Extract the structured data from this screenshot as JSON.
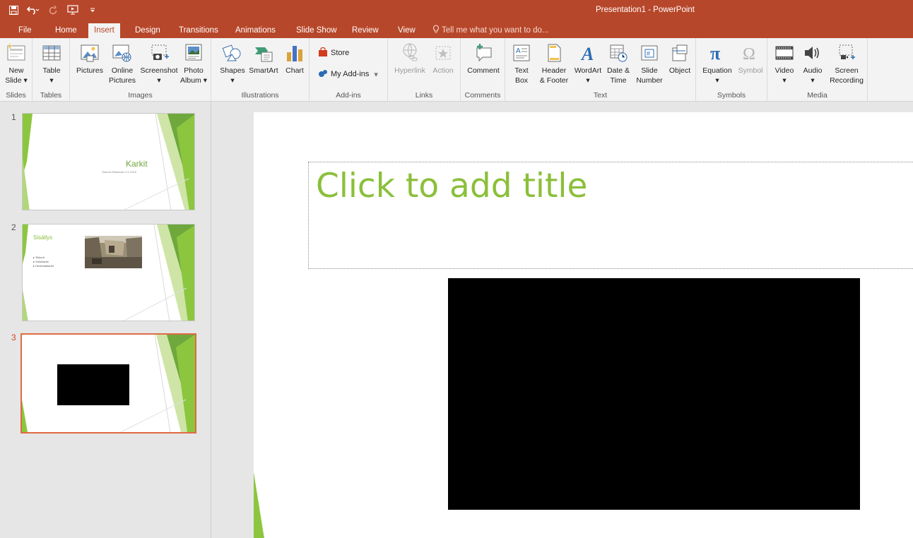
{
  "window": {
    "title": "Presentation1 - PowerPoint"
  },
  "qat": {
    "icons": [
      "save-icon",
      "undo-icon",
      "redo-icon",
      "start-from-beginning-icon",
      "customize-qat-icon"
    ]
  },
  "tabs": [
    "File",
    "Home",
    "Insert",
    "Design",
    "Transitions",
    "Animations",
    "Slide Show",
    "Review",
    "View"
  ],
  "active_tab": "Insert",
  "tell_me": "Tell me what you want to do...",
  "ribbon": {
    "slides": {
      "label": "Slides",
      "new_slide": [
        "New",
        "Slide ▾"
      ]
    },
    "tables": {
      "label": "Tables",
      "table": [
        "Table",
        "▾"
      ]
    },
    "images": {
      "label": "Images",
      "pictures": "Pictures",
      "online_pictures": [
        "Online",
        "Pictures"
      ],
      "screenshot": [
        "Screenshot",
        "▾"
      ],
      "photo_album": [
        "Photo",
        "Album ▾"
      ]
    },
    "illustrations": {
      "label": "Illustrations",
      "shapes": [
        "Shapes",
        "▾"
      ],
      "smartart": "SmartArt",
      "chart": "Chart"
    },
    "addins": {
      "label": "Add-ins",
      "store": "Store",
      "my_addins": "My Add-ins",
      "my_addins_arrow": "▾"
    },
    "links": {
      "label": "Links",
      "hyperlink": "Hyperlink",
      "action": "Action"
    },
    "comments": {
      "label": "Comments",
      "comment": "Comment"
    },
    "text": {
      "label": "Text",
      "text_box": [
        "Text",
        "Box"
      ],
      "header_footer": [
        "Header",
        "& Footer"
      ],
      "wordart": [
        "WordArt",
        "▾"
      ],
      "date_time": [
        "Date &",
        "Time"
      ],
      "slide_number": [
        "Slide",
        "Number"
      ],
      "object": "Object"
    },
    "symbols": {
      "label": "Symbols",
      "equation": [
        "Equation",
        "▾"
      ],
      "symbol": "Symbol"
    },
    "media": {
      "label": "Media",
      "video": [
        "Video",
        "▾"
      ],
      "audio": [
        "Audio",
        "▾"
      ],
      "screen_recording": [
        "Screen",
        "Recording"
      ]
    }
  },
  "thumbnails": [
    {
      "number": "1",
      "title": "Karkit",
      "subtitle": "Samuel Riekkinen 9.1.2016"
    },
    {
      "number": "2",
      "title": "Sisällys",
      "bullets": [
        "Tikkurit",
        "Sulinkarkit",
        "Hedelmäkarkit"
      ]
    },
    {
      "number": "3"
    }
  ],
  "slide": {
    "title_placeholder": "Click to add title"
  },
  "colors": {
    "accent": "#b7472a",
    "theme_green": "#8bbf3a",
    "selection": "#e06a43"
  }
}
